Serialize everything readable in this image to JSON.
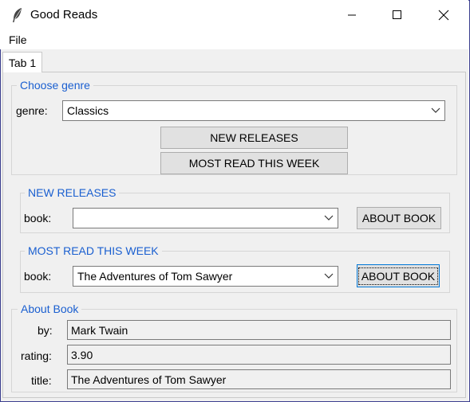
{
  "window": {
    "title": "Good Reads"
  },
  "menu": {
    "file": "File"
  },
  "tabs": [
    {
      "label": "Tab 1"
    }
  ],
  "choose_genre": {
    "frame_title": "Choose genre",
    "genre_label": "genre:",
    "genre_value": "Classics",
    "new_releases_button": "NEW RELEASES",
    "most_read_button": "MOST READ THIS WEEK"
  },
  "new_releases": {
    "frame_title": "NEW RELEASES",
    "book_label": "book:",
    "book_value": "",
    "about_button": "ABOUT BOOK"
  },
  "most_read": {
    "frame_title": "MOST READ THIS WEEK",
    "book_label": "book:",
    "book_value": "The Adventures of Tom Sawyer",
    "about_button": "ABOUT BOOK"
  },
  "about_book": {
    "frame_title": "About Book",
    "by_label": "by:",
    "by_value": "Mark Twain",
    "rating_label": "rating:",
    "rating_value": "3.90",
    "title_label": "title:",
    "title_value": "The Adventures of Tom Sawyer"
  },
  "colors": {
    "frame_title": "#1a5fd0",
    "focus_border": "#0078d7",
    "panel_bg": "#f0f0f0"
  }
}
